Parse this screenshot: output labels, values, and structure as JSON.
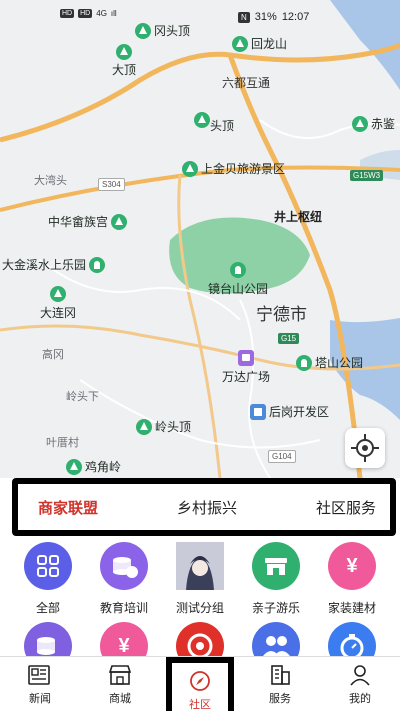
{
  "status_bar": {
    "left_chips": [
      "HD",
      "HD"
    ],
    "left_text": "4G",
    "signal_text": "ıll",
    "battery": "31%",
    "time": "12:07",
    "nfc_chip": "N"
  },
  "map": {
    "pois": [
      {
        "name": "冈头顶",
        "icon": "mountain-icon"
      },
      {
        "name": "回龙山",
        "icon": "mountain-icon"
      },
      {
        "name": "大顶",
        "icon": "mountain-icon"
      },
      {
        "name": "头顶",
        "icon": "mountain-icon"
      },
      {
        "name": "赤鉴",
        "icon": "mountain-icon"
      },
      {
        "name": "上金贝旅游景区",
        "icon": "mountain-icon"
      },
      {
        "name": "中华畲族宫",
        "icon": "mountain-icon"
      },
      {
        "name": "大金溪水上乐园",
        "icon": "park-icon"
      },
      {
        "name": "镜台山公园",
        "icon": "park-icon"
      },
      {
        "name": "大连冈",
        "icon": "mountain-icon"
      },
      {
        "name": "万达广场",
        "icon": "mall-icon"
      },
      {
        "name": "塔山公园",
        "icon": "park-icon"
      },
      {
        "name": "后岗开发区",
        "icon": "zone-icon"
      },
      {
        "name": "岭头顶",
        "icon": "mountain-icon"
      },
      {
        "name": "鸡角岭",
        "icon": "mountain-icon"
      }
    ],
    "labels": {
      "liudu": "六都互通",
      "jingshang": "井上枢纽",
      "city": "宁德市",
      "dawantou": "大湾头",
      "gaogang": "高冈",
      "lingxia": "岭头下",
      "yeju": "叶厝村"
    },
    "shields": {
      "s304": "S304",
      "g15w3": "G15W3",
      "g15": "G15",
      "g104": "G104"
    },
    "colors": {
      "road_major": "#f2b65c",
      "road_minor": "#ffffff",
      "water": "#a9c6e8",
      "park": "#8fd1a7"
    }
  },
  "tabs": [
    {
      "label": "商家联盟",
      "active": true
    },
    {
      "label": "乡村振兴",
      "active": false
    },
    {
      "label": "社区服务",
      "active": false
    }
  ],
  "categories": [
    {
      "label": "全部",
      "icon": "grid-icon",
      "color": "#5b5fe8"
    },
    {
      "label": "教育培训",
      "icon": "coins-icon",
      "color": "#8a63e8"
    },
    {
      "label": "测试分组",
      "icon": "anime-avatar-icon",
      "color": "#9aa0b5"
    },
    {
      "label": "亲子游乐",
      "icon": "shop-icon",
      "color": "#2fb06e"
    },
    {
      "label": "家装建材",
      "icon": "yen-icon",
      "color": "#f05a9a"
    },
    {
      "label": "",
      "icon": "coins-icon",
      "color": "#7f60e0"
    },
    {
      "label": "",
      "icon": "yen-icon",
      "color": "#f05a9a"
    },
    {
      "label": "",
      "icon": "target-icon",
      "color": "#e0302a"
    },
    {
      "label": "",
      "icon": "people-icon",
      "color": "#4a6fe6"
    },
    {
      "label": "",
      "icon": "stopwatch-icon",
      "color": "#3b7cf0"
    }
  ],
  "bottom_nav": [
    {
      "label": "新闻",
      "icon": "news-icon",
      "active": false
    },
    {
      "label": "商城",
      "icon": "store-icon",
      "active": false
    },
    {
      "label": "社区",
      "icon": "compass-icon",
      "active": true
    },
    {
      "label": "服务",
      "icon": "building-icon",
      "active": false
    },
    {
      "label": "我的",
      "icon": "person-icon",
      "active": false
    }
  ]
}
